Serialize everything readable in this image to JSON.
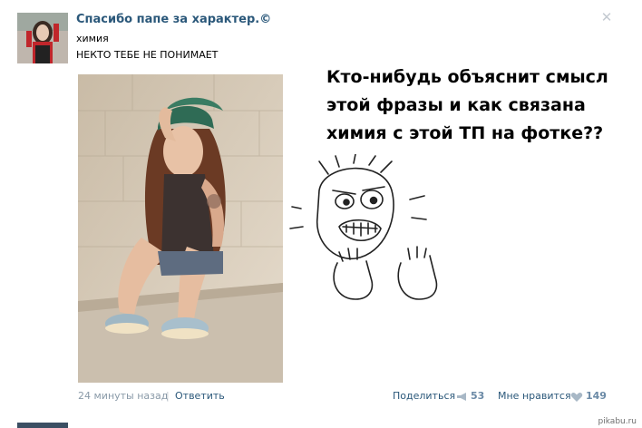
{
  "post": {
    "title": "Спасибо папе за характер.©",
    "line1": "химия",
    "line2": "НЕКТО ТЕБЕ НЕ ПОНИМАЕТ",
    "close_icon": "close-icon"
  },
  "annotation": {
    "question": "Кто-нибудь объяснит смысл этой фразы и как связана химия с этой ТП на фотке??"
  },
  "footer": {
    "time": "24 минуты назад",
    "separator": "|",
    "reply": "Ответить",
    "share_label": "Поделиться",
    "share_count": "53",
    "like_label": "Мне нравится",
    "like_count": "149"
  },
  "watermark": "pikabu.ru",
  "colors": {
    "link": "#2b587a",
    "muted": "#8a9aa8",
    "count": "#6b8aa6"
  }
}
